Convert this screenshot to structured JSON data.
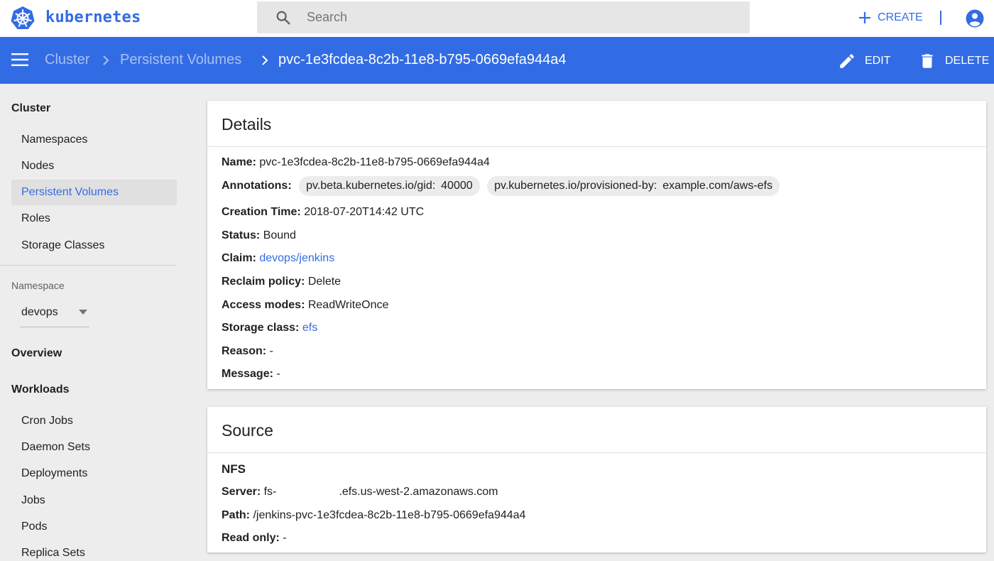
{
  "topbar": {
    "logo_text": "kubernetes",
    "search_placeholder": "Search",
    "create_label": "CREATE"
  },
  "actionbar": {
    "breadcrumbs": [
      "Cluster",
      "Persistent Volumes",
      "pvc-1e3fcdea-8c2b-11e8-b795-0669efa944a4"
    ],
    "edit_label": "EDIT",
    "delete_label": "DELETE"
  },
  "sidebar": {
    "cluster_heading": "Cluster",
    "cluster_items": [
      "Namespaces",
      "Nodes",
      "Persistent Volumes",
      "Roles",
      "Storage Classes"
    ],
    "active_item": "Persistent Volumes",
    "namespace_label": "Namespace",
    "namespace_value": "devops",
    "overview_heading": "Overview",
    "workloads_heading": "Workloads",
    "workload_items": [
      "Cron Jobs",
      "Daemon Sets",
      "Deployments",
      "Jobs",
      "Pods",
      "Replica Sets"
    ]
  },
  "details": {
    "title": "Details",
    "name_key": "Name:",
    "name_value": "pvc-1e3fcdea-8c2b-11e8-b795-0669efa944a4",
    "annotations_key": "Annotations:",
    "annotations": [
      {
        "key": "pv.beta.kubernetes.io/gid:",
        "value": "40000"
      },
      {
        "key": "pv.kubernetes.io/provisioned-by:",
        "value": "example.com/aws-efs"
      }
    ],
    "creation_key": "Creation Time:",
    "creation_value": "2018-07-20T14:42 UTC",
    "status_key": "Status:",
    "status_value": "Bound",
    "claim_key": "Claim:",
    "claim_value": "devops/jenkins",
    "reclaim_key": "Reclaim policy:",
    "reclaim_value": "Delete",
    "access_key": "Access modes:",
    "access_value": "ReadWriteOnce",
    "storage_key": "Storage class:",
    "storage_value": "efs",
    "reason_key": "Reason:",
    "reason_value": "-",
    "message_key": "Message:",
    "message_value": "-"
  },
  "source": {
    "title": "Source",
    "type": "NFS",
    "server_key": "Server:",
    "server_prefix": "fs-",
    "server_suffix": ".efs.us-west-2.amazonaws.com",
    "path_key": "Path:",
    "path_value": "/jenkins-pvc-1e3fcdea-8c2b-11e8-b795-0669efa944a4",
    "readonly_key": "Read only:",
    "readonly_value": "-"
  },
  "colors": {
    "accent": "#326ce5",
    "background": "#ededed"
  }
}
